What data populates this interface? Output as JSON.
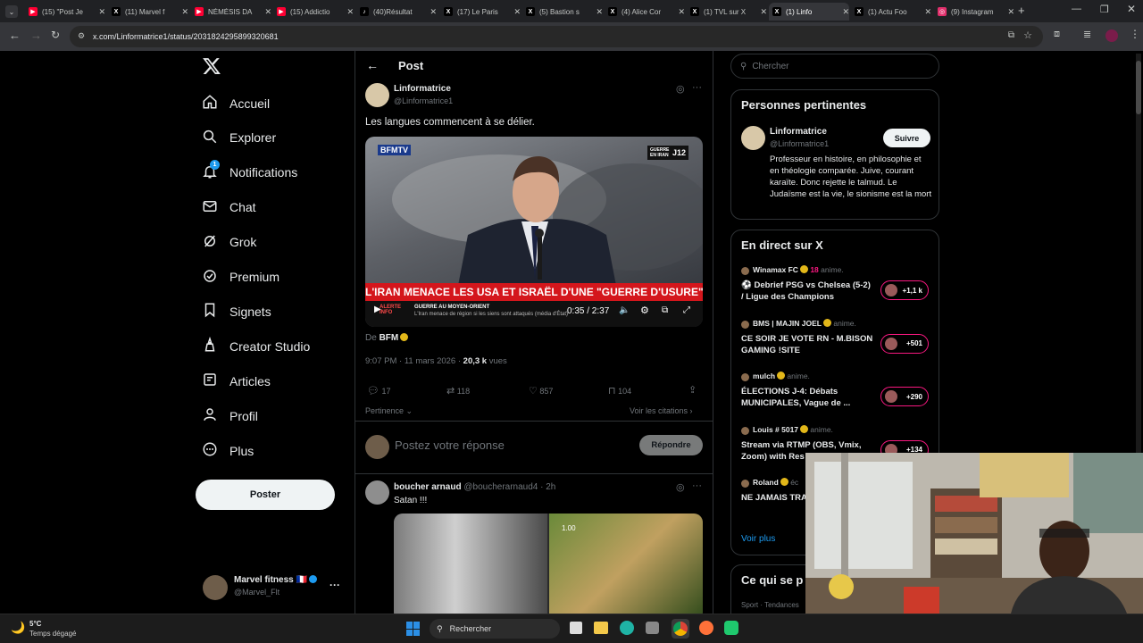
{
  "browser": {
    "tabs": [
      {
        "title": "(15) \"Post Je",
        "icon": "youtube",
        "color": "#ff0033"
      },
      {
        "title": "(11) Marvel f",
        "icon": "x-logo",
        "color": "#000000"
      },
      {
        "title": "NÉMÉSIS DA",
        "icon": "youtube",
        "color": "#ff0033"
      },
      {
        "title": "(15) Addictio",
        "icon": "youtube",
        "color": "#ff0033"
      },
      {
        "title": "(40)Résultat",
        "icon": "tiktok",
        "color": "#000000"
      },
      {
        "title": "(17) Le Paris",
        "icon": "x-logo",
        "color": "#000000"
      },
      {
        "title": "(5) Bastion s",
        "icon": "x-logo",
        "color": "#000000"
      },
      {
        "title": "(4) Alice Cor",
        "icon": "x-logo",
        "color": "#000000"
      },
      {
        "title": "(1) TVL sur X",
        "icon": "x-logo",
        "color": "#000000"
      },
      {
        "title": "(1) Linfo",
        "icon": "x-logo",
        "color": "#000000",
        "active": true
      },
      {
        "title": "(1) Actu Foo",
        "icon": "x-logo",
        "color": "#000000"
      },
      {
        "title": "(9) Instagram",
        "icon": "instagram",
        "color": "#e1306c"
      }
    ],
    "url": "x.com/Linformatrice1/status/2031824295899320681"
  },
  "nav": {
    "items": [
      {
        "label": "Accueil",
        "icon": "home-icon"
      },
      {
        "label": "Explorer",
        "icon": "search-icon"
      },
      {
        "label": "Notifications",
        "icon": "bell-icon",
        "badge": "1"
      },
      {
        "label": "Chat",
        "icon": "mail-icon"
      },
      {
        "label": "Grok",
        "icon": "grok-icon"
      },
      {
        "label": "Premium",
        "icon": "premium-icon"
      },
      {
        "label": "Signets",
        "icon": "bookmark-icon"
      },
      {
        "label": "Creator Studio",
        "icon": "creator-studio-icon"
      },
      {
        "label": "Articles",
        "icon": "articles-icon"
      },
      {
        "label": "Profil",
        "icon": "profile-icon"
      },
      {
        "label": "Plus",
        "icon": "more-icon"
      }
    ],
    "post_button": "Poster",
    "account": {
      "name": "Marvel fitness 🇫🇷",
      "handle": "@Marvel_Flt",
      "more": "···"
    }
  },
  "main": {
    "header": "Post",
    "tweet": {
      "name": "Linformatrice",
      "handle": "@Linformatrice1",
      "text": "Les langues commencent à se délier.",
      "video": {
        "headline": "L'IRAN MENACE LES USA ET ISRAËL D'UNE \"GUERRE D'USURE\"",
        "ticker_label": "ALERTE INFO",
        "ticker_title": "GUERRE AU MOYEN-ORIENT",
        "ticker_text": "L'Iran menace de région si les siens sont attaqués (média d'État)",
        "channel": "BFMTV",
        "badge": "GUERRE EN IRAN",
        "badge_day": "J12",
        "time": "0:35 / 2:37"
      },
      "source_prefix": "De",
      "source": "BFM",
      "timestamp": "9:07 PM · 11 mars 2026 ·",
      "views_count": "20,3 k",
      "views_label": "vues",
      "stats": {
        "replies": "17",
        "reposts": "118",
        "likes": "857",
        "bookmarks": "104"
      },
      "sort_label": "Pertinence",
      "quotes_label": "Voir les citations"
    },
    "reply_placeholder": "Postez votre réponse",
    "reply_button": "Répondre",
    "reply_tweet": {
      "name": "boucher arnaud",
      "handle": "@boucherarnaud4",
      "time": "· 2h",
      "text": "Satan !!!",
      "video_time": "1.00"
    }
  },
  "sidebar": {
    "search_placeholder": "Chercher",
    "relevant": {
      "title": "Personnes pertinentes",
      "name": "Linformatrice",
      "handle": "@Linformatrice1",
      "follow": "Suivre",
      "bio": "Professeur en histoire, en philosophie et en théologie comparée. Juive, courant karaïte. Donc rejette le talmud. Le Judaïsme est la vie, le sionisme est la mort"
    },
    "live": {
      "title": "En direct sur X",
      "items": [
        {
          "host": "Winamax FC",
          "extra": "18",
          "status": "anime.",
          "title": "⚽ Debrief PSG vs Chelsea (5-2) / Ligue des Champions",
          "count": "+1,1 k"
        },
        {
          "host": "BMS | MAJIN JOEL",
          "extra": "",
          "status": "anime.",
          "title": "CE SOIR JE VOTE RN - M.BISON GAMING  !SITE",
          "count": "+501"
        },
        {
          "host": "mulch",
          "extra": "",
          "status": "anime.",
          "title": "ÉLECTIONS J-4: Débats MUNICIPALES, Vague de ...",
          "count": "+290"
        },
        {
          "host": "Louis # 5017",
          "extra": "",
          "status": "anime.",
          "title": "Stream via RTMP (OBS, Vmix, Zoom) with Res",
          "count": "+134"
        },
        {
          "host": "Roland",
          "extra": "",
          "status": "éc",
          "title": "NE JAMAIS TRA CONGO 🇨🇩 ...",
          "count": ""
        }
      ],
      "more": "Voir plus"
    },
    "whats_happening": {
      "title": "Ce qui se p",
      "sub": "Sport · Tendances"
    }
  },
  "taskbar": {
    "temp": "5°C",
    "weather": "Temps dégagé",
    "search": "Rechercher"
  }
}
